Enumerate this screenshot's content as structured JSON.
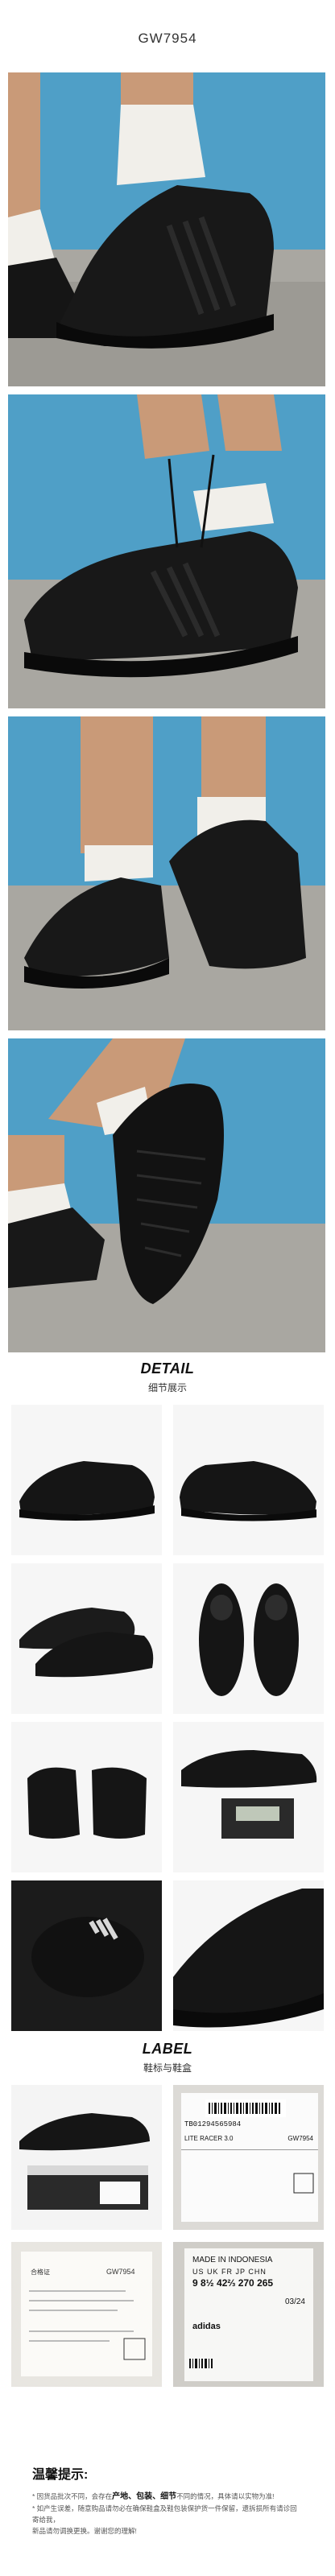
{
  "product": {
    "code": "GW7954"
  },
  "sections": {
    "detail_en": "DETAIL",
    "detail_cn": "细节展示",
    "label_en": "LABEL",
    "label_cn": "鞋标与鞋盒"
  },
  "labels": {
    "box_model": "LITE RACER 3.0",
    "box_code": "GW7954",
    "barcode_number": "TB01294565984",
    "tag_origin": "MADE IN INDONESIA",
    "tag_sizes_head": "US  UK  FR  JP  CHN",
    "tag_sizes_val": "9  8½  42⅔  270  265",
    "tag_date": "03/24",
    "tag_brand": "adidas",
    "tag_article": "GW7954",
    "card_code": "GW7954",
    "card_title": "合格证"
  },
  "tips": {
    "title": "温馨提示:",
    "line1_pre": "* 因货品批次不同，会存在",
    "line1_emph1": "产地、包装、细节",
    "line1_post": "不同的情况，具体请以实物为准!",
    "line2": "* 如产生误差，随意购品请勿必在确保鞋盒及鞋包装保护货一件保留，遗拆损所有请诊回寄给我，",
    "line3": "新品请勿调换更换。谢谢您的理解!"
  },
  "colors": {
    "sky": "#4f9fc7",
    "ground": "#a9a7a1",
    "shoe": "#151515",
    "sock": "#f1efea",
    "skin": "#c99a78"
  }
}
